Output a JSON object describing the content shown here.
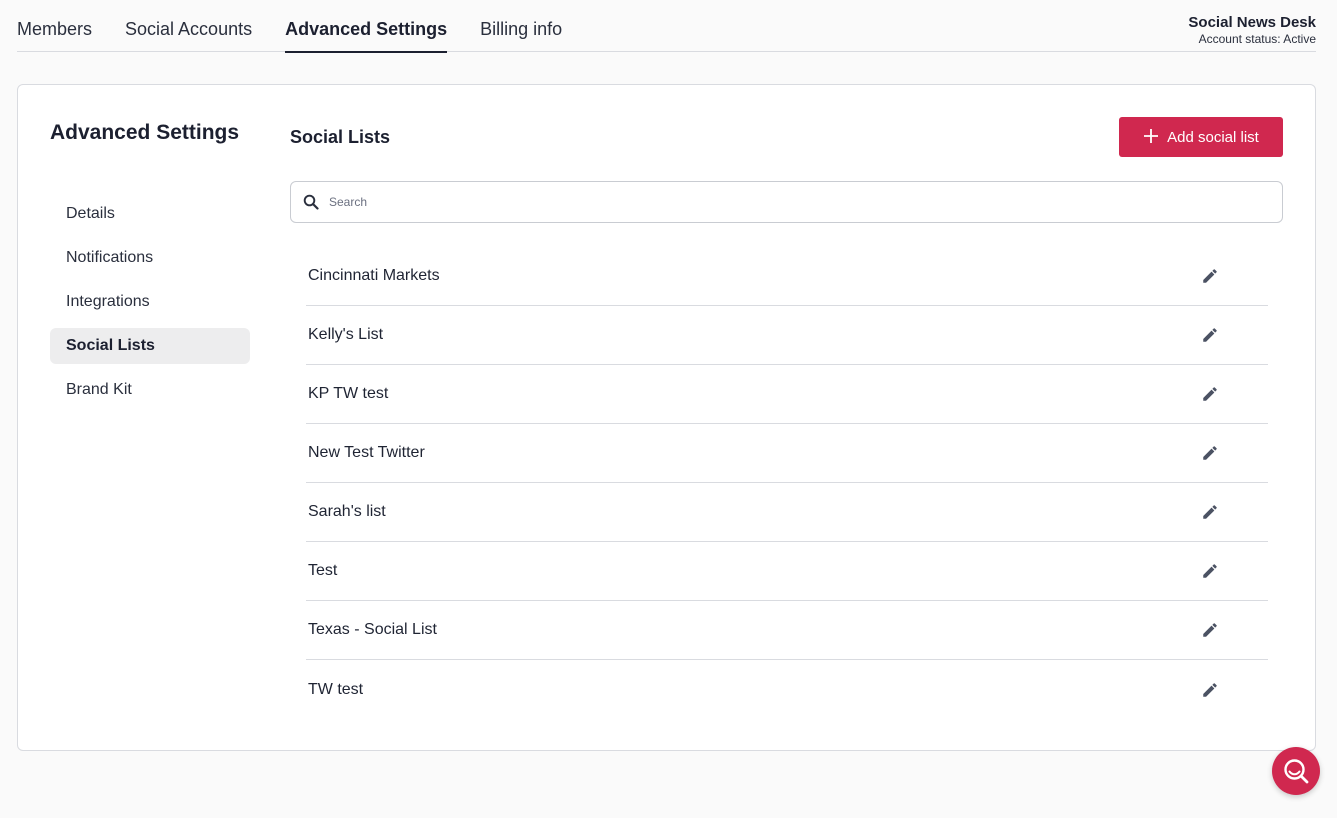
{
  "tabs": [
    {
      "label": "Members"
    },
    {
      "label": "Social Accounts"
    },
    {
      "label": "Advanced Settings",
      "active": true
    },
    {
      "label": "Billing info"
    }
  ],
  "account": {
    "name": "Social News Desk",
    "status": "Account status: Active"
  },
  "sidebar": {
    "title": "Advanced Settings",
    "items": [
      {
        "label": "Details"
      },
      {
        "label": "Notifications"
      },
      {
        "label": "Integrations"
      },
      {
        "label": "Social Lists",
        "active": true
      },
      {
        "label": "Brand Kit"
      }
    ]
  },
  "main": {
    "title": "Social Lists",
    "add_button_label": "Add social list",
    "search_placeholder": "Search",
    "lists": [
      {
        "name": "Cincinnati Markets"
      },
      {
        "name": "Kelly's List"
      },
      {
        "name": "KP TW test"
      },
      {
        "name": "New Test Twitter"
      },
      {
        "name": "Sarah's list"
      },
      {
        "name": "Test"
      },
      {
        "name": "Texas - Social List"
      },
      {
        "name": "TW test"
      }
    ]
  },
  "icons": {
    "search": "search-icon",
    "edit": "pencil-icon",
    "add": "plus-icon",
    "help": "help-search-icon"
  },
  "colors": {
    "accent": "#d0284f",
    "text": "#1f2433",
    "border": "#d9dbe0",
    "active_nav_bg": "#ededee"
  }
}
